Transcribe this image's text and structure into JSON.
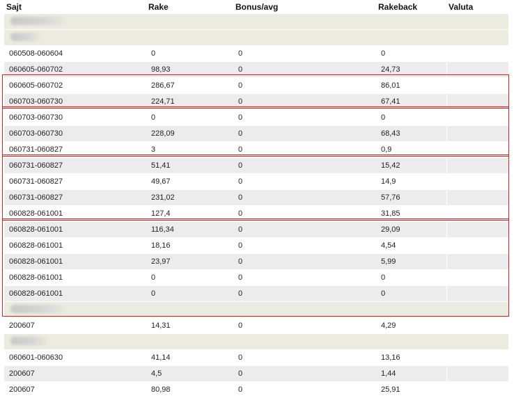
{
  "columns": [
    "Sajt",
    "Rake",
    "Bonus/avg",
    "Rakeback",
    "Valuta"
  ],
  "rows": [
    {
      "type": "group",
      "blur": 82
    },
    {
      "type": "group",
      "blur": 44
    },
    {
      "type": "data",
      "cells": [
        "060508-060604",
        "0",
        "0",
        "0",
        ""
      ]
    },
    {
      "type": "data",
      "cells": [
        "060605-060702",
        "98,93",
        "0",
        "24,73",
        ""
      ]
    },
    {
      "type": "data",
      "cells": [
        "060605-060702",
        "286,67",
        "0",
        "86,01",
        ""
      ]
    },
    {
      "type": "data",
      "cells": [
        "060703-060730",
        "224,71",
        "0",
        "67,41",
        ""
      ]
    },
    {
      "type": "data",
      "cells": [
        "060703-060730",
        "0",
        "0",
        "0",
        ""
      ]
    },
    {
      "type": "data",
      "cells": [
        "060703-060730",
        "228,09",
        "0",
        "68,43",
        ""
      ]
    },
    {
      "type": "data",
      "cells": [
        "060731-060827",
        "3",
        "0",
        "0,9",
        ""
      ]
    },
    {
      "type": "data",
      "cells": [
        "060731-060827",
        "51,41",
        "0",
        "15,42",
        ""
      ]
    },
    {
      "type": "data",
      "cells": [
        "060731-060827",
        "49,67",
        "0",
        "14,9",
        ""
      ]
    },
    {
      "type": "data",
      "cells": [
        "060731-060827",
        "231,02",
        "0",
        "57,76",
        ""
      ]
    },
    {
      "type": "data",
      "cells": [
        "060828-061001",
        "127,4",
        "0",
        "31,85",
        ""
      ]
    },
    {
      "type": "data",
      "cells": [
        "060828-061001",
        "116,34",
        "0",
        "29,09",
        ""
      ]
    },
    {
      "type": "data",
      "cells": [
        "060828-061001",
        "18,16",
        "0",
        "4,54",
        ""
      ]
    },
    {
      "type": "data",
      "cells": [
        "060828-061001",
        "23,97",
        "0",
        "5,99",
        ""
      ]
    },
    {
      "type": "data",
      "cells": [
        "060828-061001",
        "0",
        "0",
        "0",
        ""
      ]
    },
    {
      "type": "data",
      "cells": [
        "060828-061001",
        "0",
        "0",
        "0",
        ""
      ]
    },
    {
      "type": "group",
      "blur": 80
    },
    {
      "type": "data",
      "cells": [
        "200607",
        "14,31",
        "0",
        "4,29",
        ""
      ]
    },
    {
      "type": "group",
      "blur": 56
    },
    {
      "type": "data",
      "cells": [
        "060601-060630",
        "41,14",
        "0",
        "13,16",
        ""
      ]
    },
    {
      "type": "data",
      "cells": [
        "200607",
        "4,5",
        "0",
        "1,44",
        ""
      ]
    },
    {
      "type": "data",
      "cells": [
        "200607",
        "80,98",
        "0",
        "25,91",
        ""
      ]
    }
  ],
  "highlight_groups": [
    {
      "first_row": 3,
      "last_row": 4
    },
    {
      "first_row": 5,
      "last_row": 7
    },
    {
      "first_row": 8,
      "last_row": 11
    },
    {
      "first_row": 12,
      "last_row": 17
    }
  ],
  "colors": {
    "highlight": "#e02020",
    "alt_row": "#ececec",
    "group_row": "#ebebdf"
  }
}
